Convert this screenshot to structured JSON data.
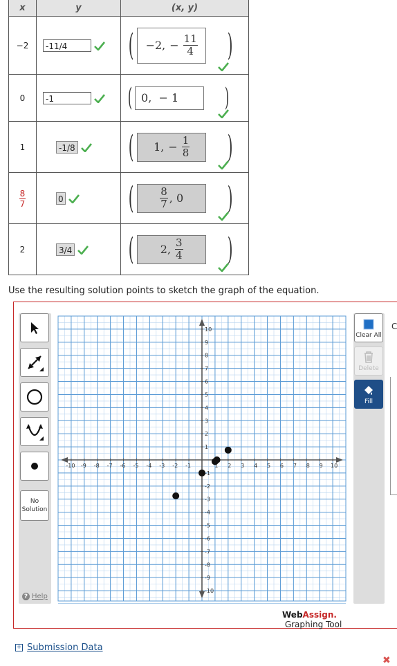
{
  "table": {
    "headers": {
      "x": "x",
      "y": "y",
      "xy": "(x, y)"
    },
    "rows": [
      {
        "x": "−2",
        "y": "-11/4",
        "pair_x": "−2,",
        "pair_y_sign": "−",
        "pair_y_num": "11",
        "pair_y_den": "4",
        "correct": true
      },
      {
        "x": "0",
        "y": "-1",
        "pair_text": "0,  − 1",
        "correct": true
      },
      {
        "x": "1",
        "y": "-1/8",
        "pair_x": "1,",
        "pair_y_sign": "−",
        "pair_y_num": "1",
        "pair_y_den": "8",
        "correct": true
      },
      {
        "x_num": "8",
        "x_den": "7",
        "y": "0",
        "pair_x_num": "8",
        "pair_x_den": "7",
        "pair_y": ", 0",
        "correct": true
      },
      {
        "x": "2",
        "y": "3/4",
        "pair_x": "2,",
        "pair_y_num": "3",
        "pair_y_den": "4",
        "correct": true
      }
    ]
  },
  "instruction": "Use the resulting solution points to sketch the graph of the equation.",
  "tools": {
    "no_solution": [
      "No",
      "Solution"
    ],
    "help": "Help",
    "clear_all": "Clear All",
    "delete": "Delete",
    "fill": "Fill"
  },
  "graph": {
    "x_ticks": [
      "-10",
      "-9",
      "-8",
      "-7",
      "-6",
      "-5",
      "-4",
      "-3",
      "-2",
      "-1",
      "1",
      "2",
      "3",
      "4",
      "5",
      "6",
      "7",
      "8",
      "9",
      "10"
    ],
    "y_ticks": [
      "10",
      "9",
      "8",
      "7",
      "6",
      "5",
      "4",
      "3",
      "2",
      "1",
      "-1",
      "-2",
      "-3",
      "-4",
      "-5",
      "-6",
      "-7",
      "-8",
      "-9",
      "-10"
    ],
    "points": [
      {
        "x": -2,
        "y": -2.75
      },
      {
        "x": 0,
        "y": -1
      },
      {
        "x": 1,
        "y": -0.125
      },
      {
        "x": 1.142857,
        "y": 0
      },
      {
        "x": 2,
        "y": 0.75
      }
    ],
    "grid_color": "#5b9bd5",
    "axis_color": "#555555"
  },
  "brand": {
    "web": "Web",
    "assign": "Assign.",
    "tool": " Graphing Tool"
  },
  "edge_char": "C",
  "submission": {
    "label": "Submission Data",
    "toggle": "+"
  },
  "close_mark": "✖"
}
